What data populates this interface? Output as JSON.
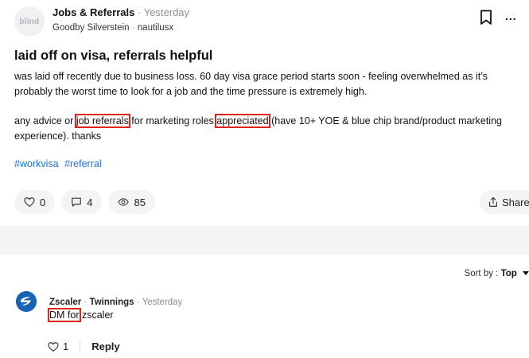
{
  "post": {
    "avatar_text": "blind",
    "channel": "Jobs & Referrals",
    "separator": "·",
    "time": "Yesterday",
    "company": "Goodby Silverstein",
    "username": "nautilusx",
    "more_label": "...",
    "title": "laid off on visa, referrals helpful",
    "paragraph1": "was laid off recently due to business loss. 60 day visa grace period starts soon - feeling overwhelmed as it’s probably the worst time to look for a job and the time pressure is extremely high.",
    "p2_part1": "any advice or ",
    "p2_highlight1": "job referrals",
    "p2_part2": " for marketing roles ",
    "p2_highlight2": "appreciated",
    "p2_part3": " (have 10+ YOE & blue chip brand/product marketing experience). thanks",
    "tags": [
      "#workvisa",
      "#referral"
    ],
    "likes": "0",
    "comments": "4",
    "views": "85",
    "share_label": "Share"
  },
  "sort": {
    "label": "Sort by :",
    "value": "Top"
  },
  "comment": {
    "company": "Zscaler",
    "username": "Twinnings",
    "time": "Yesterday",
    "highlight": "DM for",
    "text_rest": " zscaler",
    "likes": "1",
    "reply_label": "Reply"
  },
  "colors": {
    "highlight_border": "#e0241b",
    "tag_link": "#1a73e8",
    "comment_avatar": "#1664b6"
  },
  "icons": [
    "bookmark-icon",
    "more-icon",
    "heart-icon",
    "comment-icon",
    "eye-icon",
    "share-icon",
    "zscaler-logo-icon",
    "sort-caret-icon"
  ]
}
